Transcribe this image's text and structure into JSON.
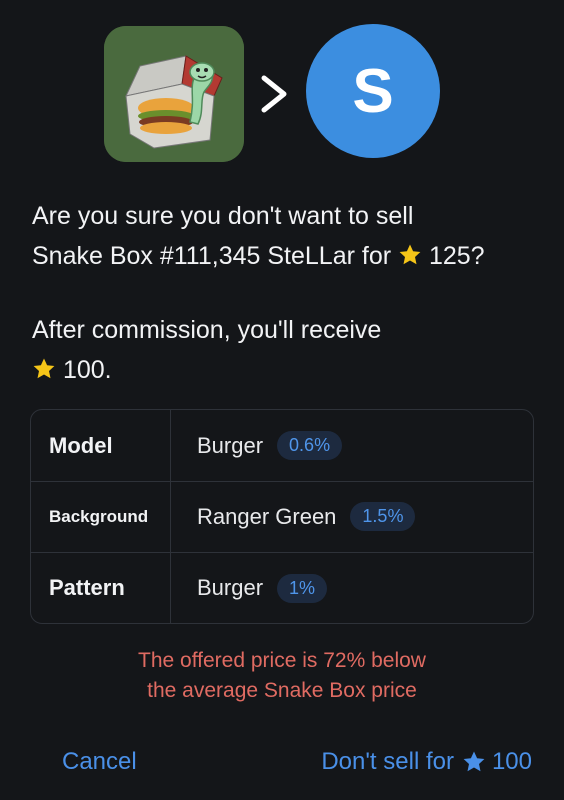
{
  "header": {
    "gift_image": "snake-box-burger",
    "arrow_icon": "chevron-right-icon",
    "avatar_letter": "S",
    "avatar_color": "#3c8ee0"
  },
  "dialog": {
    "question_line1": "Are you sure you don't want to sell",
    "question_line2_prefix": "Snake Box #111,345 SteLLar for",
    "question_price": "125?",
    "receive_text": "After commission, you'll receive",
    "receive_amount": "100."
  },
  "attributes": [
    {
      "label": "Model",
      "value": "Burger",
      "rarity": "0.6%"
    },
    {
      "label": "Background",
      "value": "Ranger Green",
      "rarity": "1.5%"
    },
    {
      "label": "Pattern",
      "value": "Burger",
      "rarity": "1%"
    }
  ],
  "warning": {
    "line1": "The offered price is 72% below",
    "line2": "the average Snake Box price"
  },
  "buttons": {
    "cancel": "Cancel",
    "dont_sell": "Don't sell for",
    "dont_sell_amount": "100"
  },
  "colors": {
    "background": "#141619",
    "accent": "#4a90e8",
    "warning": "#e06b62",
    "star": "#f5c518"
  }
}
